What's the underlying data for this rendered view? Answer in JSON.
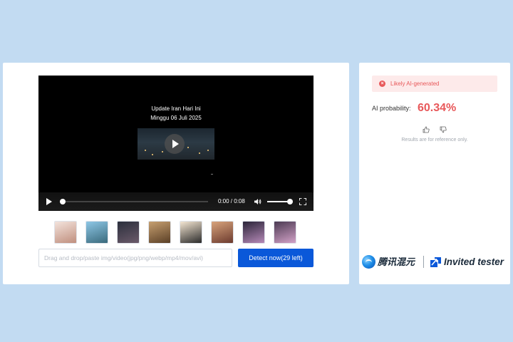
{
  "video": {
    "caption_line1": "Update Iran Hari Ini",
    "caption_line2": "Minggu 06 Juli 2025",
    "time": "0:00 / 0:08"
  },
  "samples": [
    {
      "name": "sample-1",
      "colors": [
        "#f3e3dc",
        "#c08f7e"
      ]
    },
    {
      "name": "sample-2",
      "colors": [
        "#8ec7e6",
        "#3a6a7c"
      ]
    },
    {
      "name": "sample-3",
      "colors": [
        "#2b2f3c",
        "#6b5a6a"
      ]
    },
    {
      "name": "sample-4",
      "colors": [
        "#c7a070",
        "#5a3f26"
      ]
    },
    {
      "name": "sample-5",
      "colors": [
        "#f4e6d2",
        "#2a2a2a"
      ]
    },
    {
      "name": "sample-6",
      "colors": [
        "#d8a47c",
        "#6c3a2e"
      ]
    },
    {
      "name": "sample-7",
      "colors": [
        "#2a2438",
        "#b68ab8"
      ]
    },
    {
      "name": "sample-8",
      "colors": [
        "#4b3a52",
        "#d3a2c8"
      ]
    }
  ],
  "upload": {
    "placeholder": "Drag and drop/paste img/video(jpg/png/webp/mp4/mov/avi)",
    "detect_label": "Detect now(29 left)"
  },
  "result": {
    "status": "Likely AI-generated",
    "probability_label": "AI probability:",
    "probability_value": "60.34%",
    "note": "Results are for reference only."
  },
  "branding": {
    "logo_text": "腾讯混元",
    "tester_label": "Invited tester"
  },
  "colors": {
    "background": "#c2dbf2",
    "accent": "#0a58d9",
    "danger": "#e8585a"
  }
}
